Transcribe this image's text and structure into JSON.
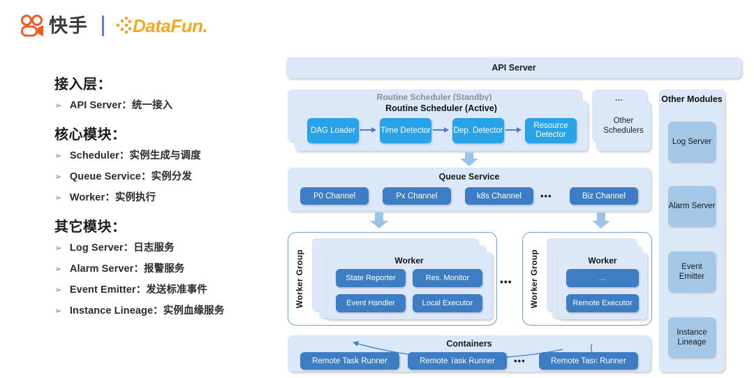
{
  "header": {
    "brand_cn": "快手",
    "brand_logo_name": "kuaishou-logo",
    "partner": "DataFun.",
    "accent_orange": "#F15A24",
    "accent_yellow": "#F5A623",
    "divider_color": "#5b7fd4"
  },
  "left_panel": {
    "sections": [
      {
        "title": "接入层：",
        "items": [
          {
            "term": "API Server",
            "sep": "：",
            "desc": "统一接入"
          }
        ]
      },
      {
        "title": "核心模块：",
        "items": [
          {
            "term": "Scheduler",
            "sep": "：",
            "desc": "实例生成与调度"
          },
          {
            "term": "Queue Service",
            "sep": "：",
            "desc": "实例分发"
          },
          {
            "term": "Worker",
            "sep": "：",
            "desc": "实例执行"
          }
        ]
      },
      {
        "title": "其它模块：",
        "items": [
          {
            "term": "Log Server",
            "sep": "：",
            "desc": "日志服务"
          },
          {
            "term": "Alarm Server",
            "sep": "：",
            "desc": "报警服务"
          },
          {
            "term": "Event Emitter",
            "sep": "：",
            "desc": "发送标准事件"
          },
          {
            "term": "Instance Lineage",
            "sep": "：",
            "desc": "实例血缘服务"
          }
        ]
      }
    ],
    "bullet_glyph": "➢"
  },
  "diagram": {
    "api_server": "API Server",
    "scheduler": {
      "standby_label": "Routine Scheduler (Standby)",
      "active_label": "Routine Scheduler (Active)",
      "stages": [
        "DAG Loader",
        "Time Detector",
        "Dep. Detector",
        "Resource Detector"
      ],
      "stage_color": "#29A3E8"
    },
    "other_schedulers": {
      "back_dots": "…",
      "label": "Other Schedulers"
    },
    "other_modules": {
      "title": "Other Modules",
      "items": [
        "Log Server",
        "Alarm Server",
        "Event Emitter",
        "Instance Lineage"
      ],
      "item_color": "#a6c8e8"
    },
    "queue_service": {
      "title": "Queue Service",
      "channels": [
        "P0 Channel",
        "Px Channel",
        "k8s Channel",
        "Biz Channel"
      ],
      "ellipsis": "•••",
      "channel_color": "#3C7DC4"
    },
    "worker_groups": [
      {
        "group_label": "Worker Group",
        "worker_title": "Worker",
        "components": [
          "State Reporter",
          "Res. Monitor",
          "Event Handler",
          "Local Executor"
        ]
      },
      {
        "group_label": "Worker Group",
        "worker_title": "Worker",
        "components": [
          "…",
          "Remote Executor"
        ]
      }
    ],
    "worker_groups_ellipsis": "•••",
    "containers": {
      "title": "Containers",
      "runners": [
        "Remote Task Runner",
        "Remote Task Runner",
        "Remote Task Runner"
      ],
      "ellipsis": "•••"
    },
    "panel_color": "#dbe8f7",
    "arrow_color": "#9cc3e8",
    "thin_arrow_color": "#3c7dc4"
  }
}
